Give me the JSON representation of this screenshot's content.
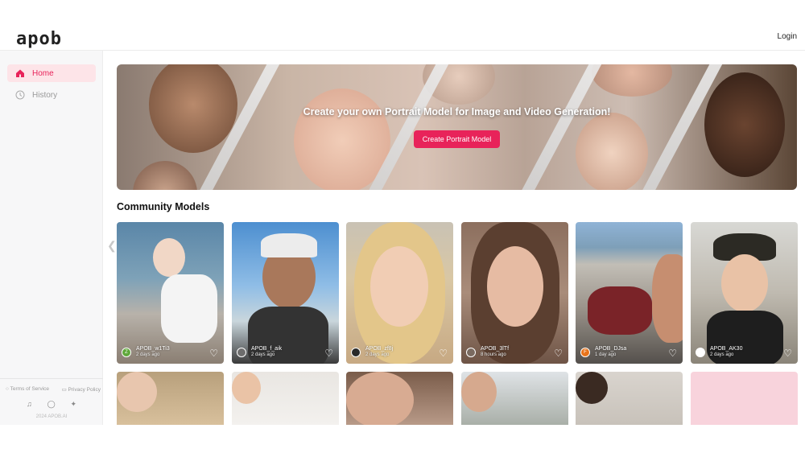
{
  "header": {
    "logo": "apob",
    "login_label": "Login"
  },
  "sidebar": {
    "items": [
      {
        "label": "Home",
        "icon": "home-icon",
        "active": true
      },
      {
        "label": "History",
        "icon": "clock-icon",
        "active": false
      }
    ],
    "footer": {
      "terms": "Terms of Service",
      "privacy": "Privacy Policy",
      "socials": [
        "tiktok-icon",
        "instagram-icon",
        "twitter-icon"
      ],
      "copyright": "2024 APOB.AI"
    }
  },
  "banner": {
    "title": "Create your own Portrait Model for Image and Video Generation!",
    "button_label": "Create Portrait Model"
  },
  "community": {
    "title": "Community Models",
    "cards": [
      {
        "user": "APOB_w1Ti3",
        "time": "2 days ago",
        "avatar": "Z",
        "avatar_color": "#5fa83a"
      },
      {
        "user": "APOB_f_aik",
        "time": "2 days ago",
        "avatar": "",
        "avatar_color": "#6d6d6d"
      },
      {
        "user": "APOB_zf8j",
        "time": "2 days ago",
        "avatar": "",
        "avatar_color": "#2a2a2a"
      },
      {
        "user": "APOB_3lTf",
        "time": "8 hours ago",
        "avatar": "",
        "avatar_color": "#7a6a60"
      },
      {
        "user": "APOB_DJsa",
        "time": "1 day ago",
        "avatar": "F",
        "avatar_color": "#e8731a"
      },
      {
        "user": "APOB_AK30",
        "time": "2 days ago",
        "avatar": "",
        "avatar_color": "#ffffff"
      }
    ]
  },
  "colors": {
    "accent": "#e8235a",
    "active_bg": "#fde4e8"
  }
}
